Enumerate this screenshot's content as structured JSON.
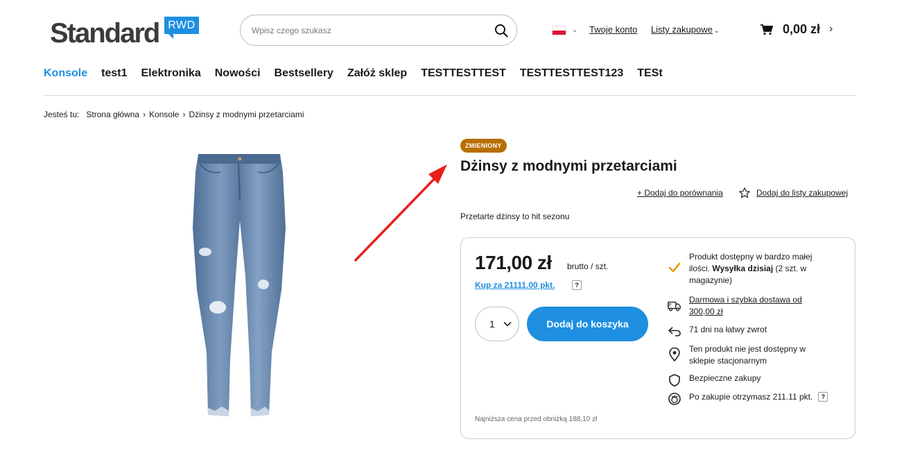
{
  "header": {
    "logo_text": "Standard",
    "logo_badge": "RWD",
    "search_placeholder": "Wpisz czego szukasz",
    "account_link": "Twoje konto",
    "lists_link": "Listy zakupowe",
    "cart_total": "0,00 zł"
  },
  "nav": {
    "items": [
      "Konsole",
      "test1",
      "Elektronika",
      "Nowości",
      "Bestsellery",
      "Załóż sklep",
      "TESTTESTTEST",
      "TESTTESTTEST123",
      "TESt"
    ],
    "active": "Konsole"
  },
  "breadcrumb": {
    "label": "Jesteś tu:",
    "items": [
      "Strona główna",
      "Konsole",
      "Dżinsy z modnymi przetarciami"
    ]
  },
  "product": {
    "badge": "ZMIENIONY",
    "title": "Dżinsy z modnymi przetarciami",
    "compare_link": "+ Dodaj do porównania",
    "wishlist_link": "Dodaj do listy zakupowej",
    "short_description": "Przetarte dżinsy to hit sezonu",
    "price": "171,00 zł",
    "price_unit": "brutto / szt.",
    "points_link": "Kup za 21111.00 pkt.",
    "help_mark": "?",
    "quantity": "1",
    "add_to_cart": "Dodaj do koszyka",
    "lowest_price_note": "Najniższa cena przed obniżką 188,10 zł",
    "features": [
      {
        "icon": "check-icon",
        "pre": "Produkt dostępny w bardzo małej ilości. ",
        "bold": "Wysyłka dzisiaj",
        "post": " (2 szt. w magazynie)"
      },
      {
        "icon": "truck-icon",
        "text": "Darmowa i szybka dostawa od 300,00 zł"
      },
      {
        "icon": "return-icon",
        "text": "71 dni na łatwy zwrot"
      },
      {
        "icon": "location-icon",
        "text": "Ten produkt nie jest dostępny w sklepie stacjonarnym"
      },
      {
        "icon": "shield-icon",
        "text": "Bezpieczne zakupy"
      },
      {
        "icon": "points-icon",
        "text": "Po zakupie otrzymasz 211.11 pkt."
      }
    ]
  },
  "colors": {
    "accent": "#1e8fe1",
    "badge": "#b86e00",
    "check": "#e0a100",
    "annotation_arrow": "#e8201c"
  }
}
